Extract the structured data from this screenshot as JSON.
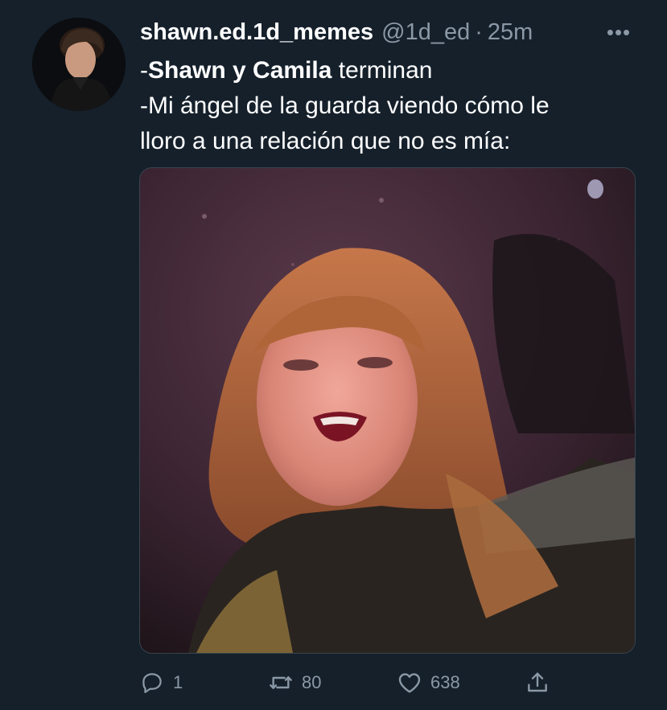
{
  "tweet": {
    "display_name": "shawn.ed.1d_memes",
    "handle": "@1d_ed",
    "separator": "·",
    "time": "25m",
    "more_label": "•••",
    "text": {
      "line1_prefix": "-",
      "line1_bold": "Shawn y Camila",
      "line1_rest": " terminan",
      "line2": "-Mi ángel de la guarda viendo cómo le",
      "line3": "lloro a una relación que no es mía:"
    }
  },
  "actions": {
    "reply_count": "1",
    "retweet_count": "80",
    "like_count": "638"
  },
  "icons": {
    "reply": "reply-icon",
    "retweet": "retweet-icon",
    "like": "heart-icon",
    "share": "share-icon",
    "more": "more-icon"
  },
  "colors": {
    "background": "#15202b",
    "secondary_text": "#8b98a5",
    "primary_text": "#ffffff",
    "border": "#38444d"
  }
}
